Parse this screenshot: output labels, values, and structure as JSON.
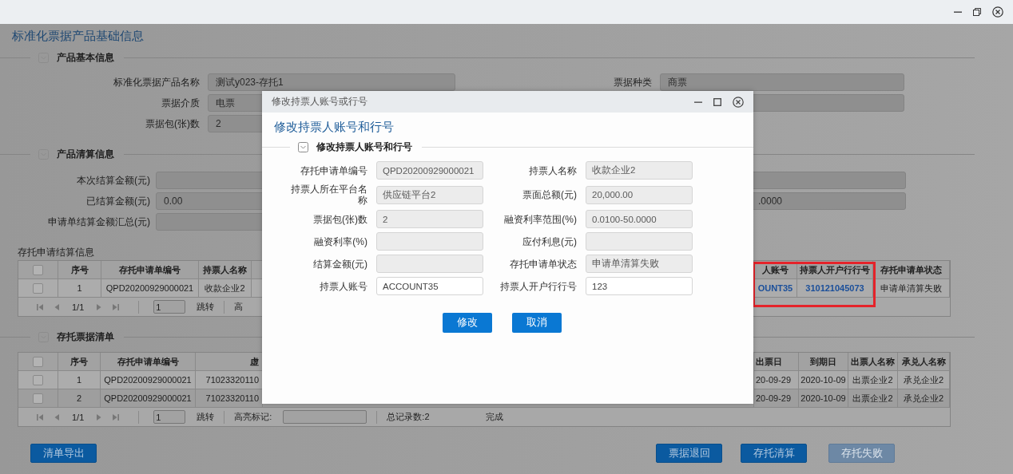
{
  "page": {
    "title": "标准化票据产品基础信息"
  },
  "basic_info": {
    "title": "产品基本信息",
    "fields": [
      {
        "label": "标准化票据产品名称",
        "value": "测试y023-存托1"
      },
      {
        "label": "票据介质",
        "value": "电票"
      },
      {
        "label": "票据包(张)数",
        "value": "2"
      }
    ],
    "right_fields": [
      {
        "label": "票据种类",
        "value": "商票"
      }
    ]
  },
  "settlement_info": {
    "title": "产品清算信息",
    "fields": [
      {
        "label": "本次结算金额(元)"
      },
      {
        "label": "已结算金额(元)",
        "value": "0.00"
      },
      {
        "label": "申请单结算金额汇总(元)"
      }
    ],
    "right_field_value": ".0000"
  },
  "settlement_table": {
    "caption": "存托申请结算信息",
    "all_checked": false,
    "columns": [
      {
        "label": "序号",
        "kind": "text"
      },
      {
        "label": "存托申请单编号",
        "kind": "text"
      },
      {
        "label": "持票人名称",
        "kind": "text"
      },
      {
        "kind": "hidden"
      },
      {
        "label": "人账号",
        "kind": "link"
      },
      {
        "label": "持票人开户行行号",
        "kind": "link"
      },
      {
        "label": "存托申请单状态",
        "kind": "text"
      }
    ],
    "rows": [
      {
        "checked": false,
        "cells": [
          "1",
          "QPD20200929000021",
          "收款企业2",
          "",
          "OUNT35",
          "310121045073",
          "申请单清算失败"
        ]
      }
    ],
    "pager": {
      "page": "1/1",
      "page_input": "1",
      "jump": "跳转",
      "highlight_label": "高"
    }
  },
  "bills_info": {
    "title": "存托票据清单"
  },
  "bills_table": {
    "all_checked": false,
    "columns": [
      {
        "label": "序号",
        "kind": "text"
      },
      {
        "label": "存托申请单编号",
        "kind": "text"
      },
      {
        "label": "虚",
        "kind": "clipped"
      },
      {
        "kind": "hidden"
      },
      {
        "label": "出票日",
        "kind": "clipped-left"
      },
      {
        "label": "到期日",
        "kind": "text"
      },
      {
        "label": "出票人名称",
        "kind": "text"
      },
      {
        "label": "承兑人名称",
        "kind": "text"
      }
    ],
    "rows": [
      {
        "checked": false,
        "cells": [
          "1",
          "QPD20200929000021",
          "71023320110",
          "",
          "20-09-29",
          "2020-10-09",
          "出票企业2",
          "承兑企业2"
        ]
      },
      {
        "checked": false,
        "cells": [
          "2",
          "QPD20200929000021",
          "71023320110",
          "",
          "20-09-29",
          "2020-10-09",
          "出票企业2",
          "承兑企业2"
        ]
      }
    ],
    "pager": {
      "page": "1/1",
      "page_input": "1",
      "jump": "跳转",
      "highlight_label": "高亮标记:",
      "total": "总记录数:2",
      "status": "完成"
    }
  },
  "buttons": [
    {
      "label": "清单导出",
      "disabled": false
    },
    {
      "label": "票据退回",
      "disabled": false
    },
    {
      "label": "存托清算",
      "disabled": false
    },
    {
      "label": "存托失败",
      "disabled": true
    }
  ],
  "modal": {
    "title": "修改持票人账号或行号",
    "heading": "修改持票人账号和行号",
    "section": "修改持票人账号和行号",
    "fields": [
      {
        "label": "存托申请单编号",
        "value": "QPD20200929000021",
        "editable": false
      },
      {
        "label": "持票人名称",
        "value": "收款企业2",
        "editable": false
      },
      {
        "label": "持票人所在平台名称",
        "value": "供应链平台2",
        "editable": false
      },
      {
        "label": "票面总额(元)",
        "value": "20,000.00",
        "editable": false
      },
      {
        "label": "票据包(张)数",
        "value": "2",
        "editable": false
      },
      {
        "label": "融资利率范围(%)",
        "value": "0.0100-50.0000",
        "editable": false
      },
      {
        "label": "融资利率(%)",
        "editable": false
      },
      {
        "label": "应付利息(元)",
        "editable": false
      },
      {
        "label": "结算金额(元)",
        "editable": false
      },
      {
        "label": "存托申请单状态",
        "value": "申请单清算失败",
        "editable": false
      },
      {
        "label": "持票人账号",
        "value": "ACCOUNT35",
        "editable": true
      },
      {
        "label": "持票人开户行行号",
        "value": "123",
        "editable": true
      }
    ],
    "buttons": [
      "修改",
      "取消"
    ]
  }
}
